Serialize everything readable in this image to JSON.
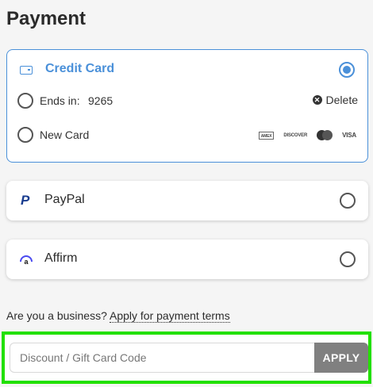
{
  "title": "Payment",
  "credit_card": {
    "label": "Credit Card",
    "selected": true,
    "saved_card": {
      "label": "Ends in:",
      "last4": "9265",
      "delete_label": "Delete"
    },
    "new_card_label": "New Card",
    "brands": [
      "AMEX",
      "DISCOVER",
      "mastercard",
      "VISA"
    ]
  },
  "paypal": {
    "label": "PayPal",
    "icon": "paypal-icon"
  },
  "affirm": {
    "label": "Affirm",
    "icon": "affirm-icon"
  },
  "business": {
    "prefix": "Are you a business?",
    "link": "Apply for payment terms"
  },
  "discount": {
    "placeholder": "Discount / Gift Card Code",
    "apply_label": "APPLY"
  },
  "colors": {
    "accent": "#4a90d9",
    "highlight": "#22e000",
    "apply_bg": "#808080"
  }
}
